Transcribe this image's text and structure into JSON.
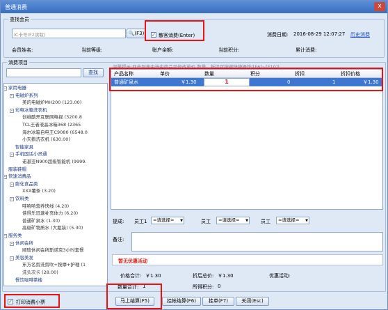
{
  "window": {
    "title": "普通消费",
    "close_glyph": "x"
  },
  "member_group": {
    "title": "查找会员",
    "card_placeholder": "IC卡号(F2读取)",
    "search_btn": "(F3)",
    "guest_label": "散客消费(Enter)",
    "guest_checked": "✓",
    "date_label": "消费日期:",
    "date_value": "2016-08-29 12:07:27",
    "history_link": "历史消费",
    "name_label": "会员姓名:",
    "level_label": "当前等级:",
    "balance_label": "账户余额:",
    "points_label": "当前积分:",
    "cumulative_label": "累计消费:"
  },
  "items_group": {
    "title": "消费项目",
    "search_btn": "查找",
    "hint": "温馨提示:双击列表中选中商品可修改单价,数量。折扣可按键快捷操作([F6]~[F10])"
  },
  "tree": [
    {
      "text": "家用电器",
      "level": 0,
      "exp": "-"
    },
    {
      "text": "电磁炉系列",
      "level": 1,
      "exp": "-"
    },
    {
      "text": "美的电磁炉MH200 (123.00)",
      "level": 2,
      "exp": ""
    },
    {
      "text": "彩电冰箱洗衣机",
      "level": 1,
      "exp": "-"
    },
    {
      "text": "创维酷开互联网电视 (3200.8",
      "level": 2,
      "exp": ""
    },
    {
      "text": "TCL王者液晶冰箱368 (2365",
      "level": 2,
      "exp": ""
    },
    {
      "text": "海尔冰箱自电王C9080 (6548.0",
      "level": 2,
      "exp": ""
    },
    {
      "text": "小天鹅洗衣机 (630.00)",
      "level": 2,
      "exp": ""
    },
    {
      "text": "智能家具",
      "level": 1,
      "exp": ""
    },
    {
      "text": "手机固话小灵通",
      "level": 1,
      "exp": "-"
    },
    {
      "text": "诺基亚N900超级智能机 (9999.",
      "level": 2,
      "exp": ""
    },
    {
      "text": "服装鞋帽",
      "level": 0,
      "exp": ""
    },
    {
      "text": "快速消费品",
      "level": 0,
      "exp": "-"
    },
    {
      "text": "膨化食品类",
      "level": 1,
      "exp": "-"
    },
    {
      "text": "XXX薯条 (3.20)",
      "level": 2,
      "exp": ""
    },
    {
      "text": "饮料类",
      "level": 1,
      "exp": "-"
    },
    {
      "text": "哇哈哈营养快线 (4.20)",
      "level": 2,
      "exp": ""
    },
    {
      "text": "佳得乐迅速补充体力 (6.20)",
      "level": 2,
      "exp": ""
    },
    {
      "text": "普通矿泉水 (1.30)",
      "level": 2,
      "exp": ""
    },
    {
      "text": "高级矿物质水 (大瓶装) (5.30)",
      "level": 2,
      "exp": ""
    },
    {
      "text": "服务类",
      "level": 0,
      "exp": "-"
    },
    {
      "text": "休闲会所",
      "level": 1,
      "exp": "-"
    },
    {
      "text": "顺琉休闲会所斯诺克3小时套餐",
      "level": 2,
      "exp": ""
    },
    {
      "text": "美容美发",
      "level": 1,
      "exp": "-"
    },
    {
      "text": "东方名剪洗剪吹+按摩+护理 (1",
      "level": 2,
      "exp": ""
    },
    {
      "text": "洗头次卡 (28.00)",
      "level": 2,
      "exp": ""
    },
    {
      "text": "餐饮咖啡茶楼",
      "level": 1,
      "exp": ""
    }
  ],
  "grid": {
    "headers": [
      "产品名称",
      "单价",
      "数量",
      "积分",
      "折扣",
      "折扣价格"
    ],
    "rows": [
      {
        "name": "普通矿泉水",
        "price": "￥1.30",
        "qty": "1",
        "points": "0",
        "discount": "1",
        "disc_price": "￥1.30"
      }
    ]
  },
  "staff": {
    "label": "提成:",
    "emp1_label": "员工1",
    "emp_label": "员工",
    "emp3_label": "员工",
    "select_text": "=请选择="
  },
  "remark_label": "备注:",
  "promo": {
    "text": "暂无优惠活动",
    "color": "#d9201a"
  },
  "totals": {
    "price_total_label": "价格合计:",
    "price_total": "￥1.30",
    "disc_total_label": "折后总价:",
    "disc_total": "￥1.30",
    "promo_label": "优惠活动:",
    "qty_total_label": "数量合计:",
    "qty_total": "1",
    "points_earned_label": "所得积分:",
    "points_earned": "0"
  },
  "footer": {
    "print_label": "打印消费小票",
    "print_checked": "✓",
    "checkout": "马上结算(F5)",
    "hang_checkout": "挂帐结算(F6)",
    "hang": "挂单(F7)",
    "close": "关闭(Esc)"
  },
  "colors": {
    "accent_row": "#3d77d0",
    "red_highlight": "#e11",
    "link": "#1f4fc8"
  }
}
